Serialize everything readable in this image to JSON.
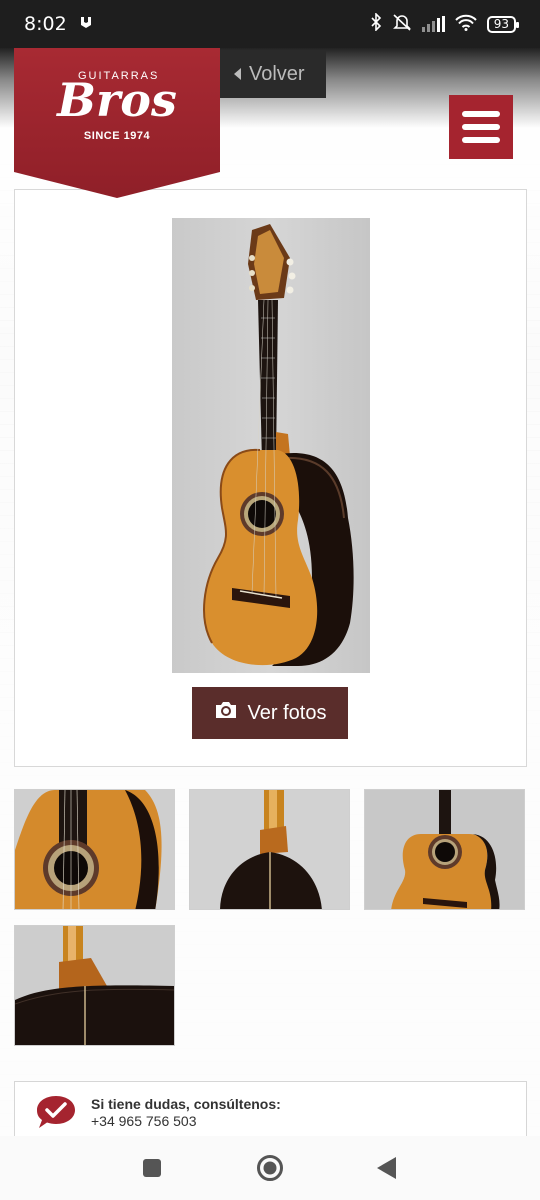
{
  "status_bar": {
    "time": "8:02",
    "battery": "93",
    "icons": [
      "notification-icon",
      "bluetooth-icon",
      "mute-icon",
      "signal-icon",
      "wifi-icon",
      "battery-icon"
    ]
  },
  "header": {
    "logo": {
      "small_text": "GUITARRAS",
      "main_text": "Bros",
      "tagline": "SINCE 1974"
    },
    "back_label": "Volver",
    "menu_icon": "hamburger-icon"
  },
  "product": {
    "photo_alt": "classical guitar",
    "gallery_button": "Ver fotos",
    "gallery_button_icon": "camera-icon"
  },
  "thumbnails": [
    {
      "name": "thumbnail-soundboard-closeup"
    },
    {
      "name": "thumbnail-back-view"
    },
    {
      "name": "thumbnail-front-view"
    },
    {
      "name": "thumbnail-heel-detail"
    }
  ],
  "contact": {
    "title": "Si tiene dudas, consúltenos:",
    "phone": "+34 965 756 503",
    "icon": "check-chat-icon"
  },
  "colors": {
    "brand_red": "#a5242f",
    "button_brown": "#5a2d2b",
    "wood": "#d98f2e",
    "dark_wood": "#241611"
  },
  "system_nav": [
    "recents-button",
    "home-button",
    "back-button"
  ]
}
